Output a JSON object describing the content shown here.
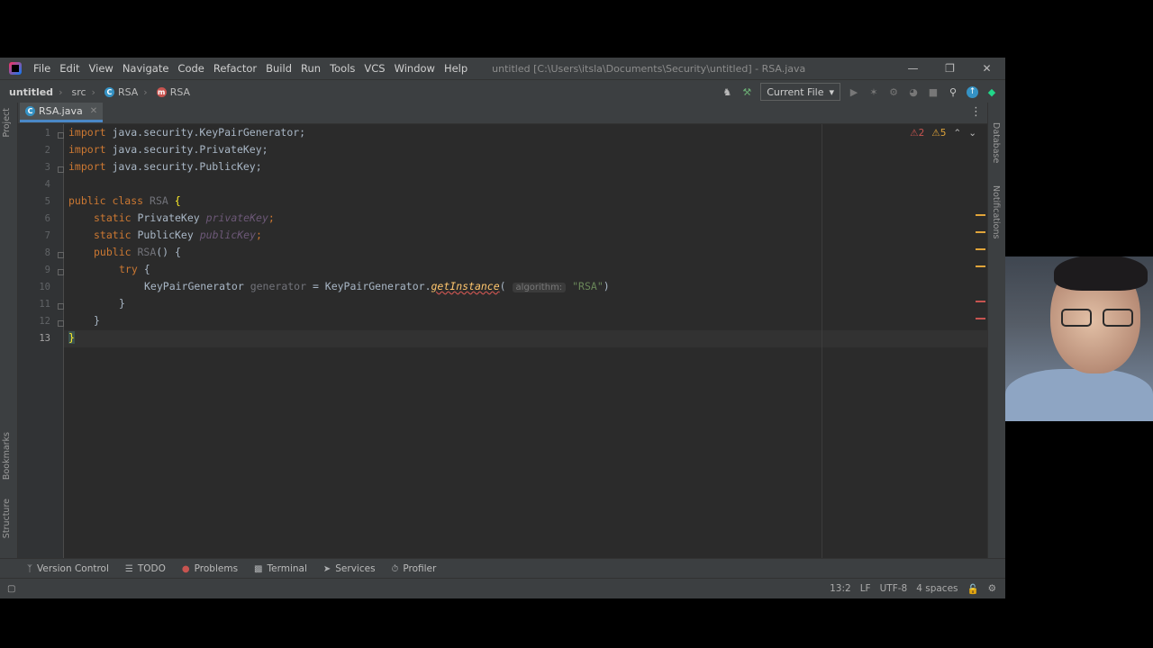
{
  "window": {
    "title": "untitled [C:\\Users\\itsla\\Documents\\Security\\untitled] - RSA.java",
    "menu": [
      "File",
      "Edit",
      "View",
      "Navigate",
      "Code",
      "Refactor",
      "Build",
      "Run",
      "Tools",
      "VCS",
      "Window",
      "Help"
    ]
  },
  "nav": {
    "project": "untitled",
    "src": "src",
    "class_crumb": "RSA",
    "method_crumb": "RSA",
    "run_config": "Current File"
  },
  "tabs": [
    {
      "label": "RSA.java"
    }
  ],
  "left_stripe": {
    "project": "Project",
    "bookmarks": "Bookmarks",
    "structure": "Structure"
  },
  "right_stripe": {
    "database": "Database",
    "notifications": "Notifications"
  },
  "inspections": {
    "errors": "2",
    "warnings": "5"
  },
  "editor": {
    "line_numbers": [
      "1",
      "2",
      "3",
      "4",
      "5",
      "6",
      "7",
      "8",
      "9",
      "10",
      "11",
      "12",
      "13"
    ],
    "current_line": "13",
    "lines": {
      "l1_kw": "import",
      "l1_rest": " java.security.KeyPairGenerator;",
      "l2_kw": "import",
      "l2_rest": " java.security.PrivateKey;",
      "l3_kw": "import",
      "l3_rest": " java.security.PublicKey;",
      "l5_kw": "public class",
      "l5_name": " RSA ",
      "l5_brace": "{",
      "l6_kw": "static",
      "l6_type": " PrivateKey ",
      "l6_field": "privateKey",
      "l6_semi": ";",
      "l7_kw": "static",
      "l7_type": " PublicKey ",
      "l7_field": "publicKey",
      "l7_semi": ";",
      "l8_kw": "public",
      "l8_name": " RSA",
      "l8_rest": "() {",
      "l9_kw": "try",
      "l9_rest": " {",
      "l10_type": "KeyPairGenerator ",
      "l10_var": "generator",
      "l10_eq": " = KeyPairGenerator.",
      "l10_method": "getInstance",
      "l10_paren": "(",
      "l10_hint": "algorithm:",
      "l10_str": "\"RSA\"",
      "l10_close": ")",
      "l11": "}",
      "l12": "}",
      "l13": "}"
    }
  },
  "bottom_tools": [
    {
      "label": "Version Control",
      "icon": "branch-icon"
    },
    {
      "label": "TODO",
      "icon": "list-icon"
    },
    {
      "label": "Problems",
      "icon": "error-icon"
    },
    {
      "label": "Terminal",
      "icon": "terminal-icon"
    },
    {
      "label": "Services",
      "icon": "services-icon"
    },
    {
      "label": "Profiler",
      "icon": "profiler-icon"
    }
  ],
  "status": {
    "position": "13:2",
    "line_sep": "LF",
    "encoding": "UTF-8",
    "indent": "4 spaces"
  },
  "colors": {
    "accent": "#4a88c7",
    "keyword": "#cc7832",
    "string": "#6a8759",
    "error": "#c75450",
    "warning": "#e0a43a"
  }
}
